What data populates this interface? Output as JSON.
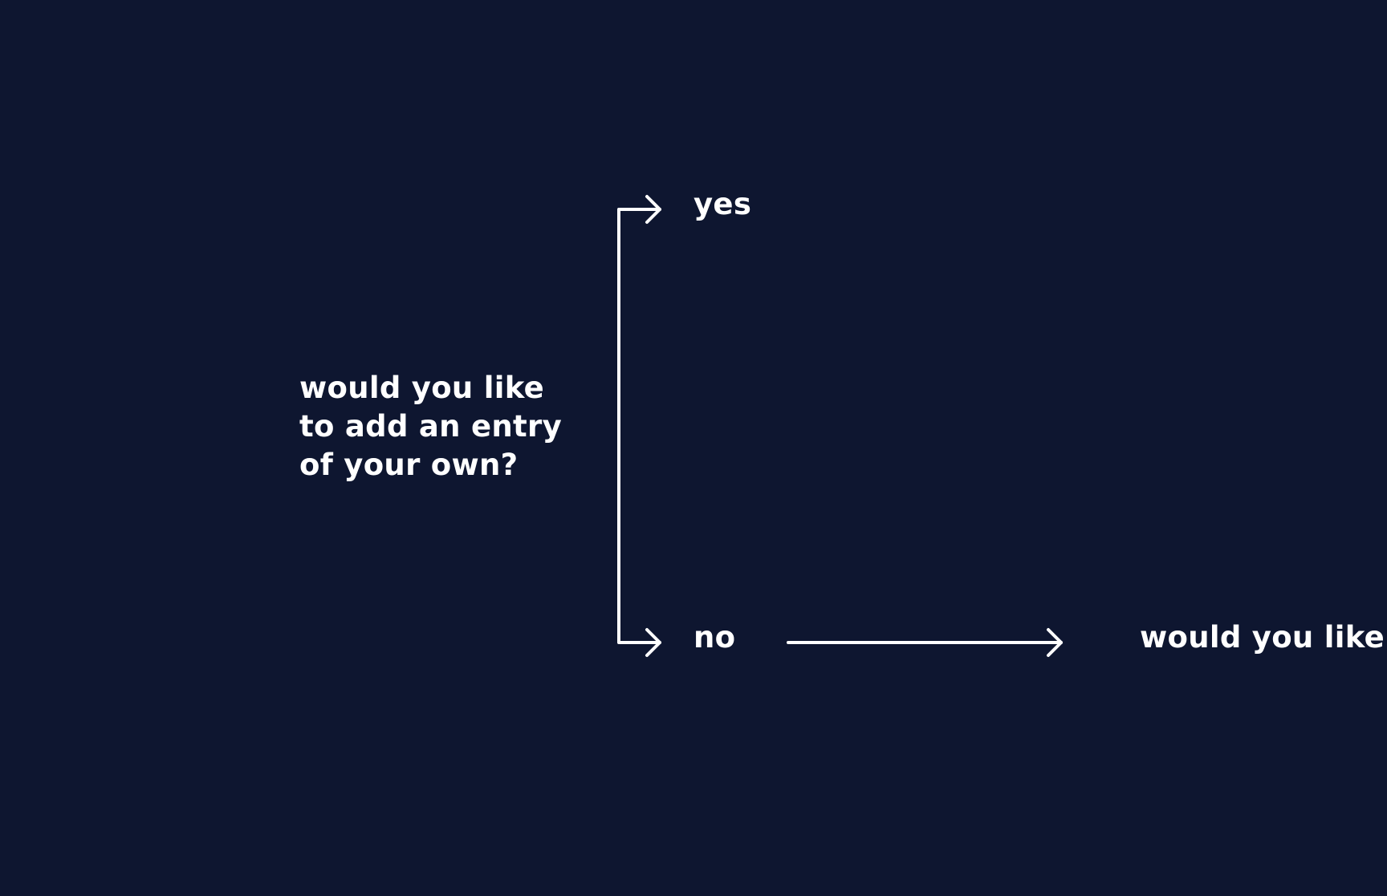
{
  "diagram": {
    "question": "would you like\nto add an entry\nof your own?",
    "options": {
      "yes": "yes",
      "no": "no"
    },
    "next_question": "would you like t"
  },
  "colors": {
    "background": "#0e1630",
    "foreground": "#ffffff"
  }
}
